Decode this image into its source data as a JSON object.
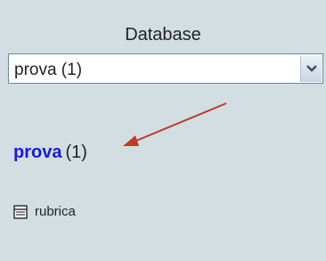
{
  "sidebar": {
    "db_label": "Database",
    "select": {
      "value": "prova (1)"
    },
    "db_link": {
      "name": "prova",
      "count": "(1)"
    },
    "tables": [
      {
        "label": "rubrica",
        "icon": "table-icon"
      }
    ]
  },
  "colors": {
    "background": "#d2dee2",
    "link": "#1a1ad6",
    "arrow": "#c0392b"
  }
}
